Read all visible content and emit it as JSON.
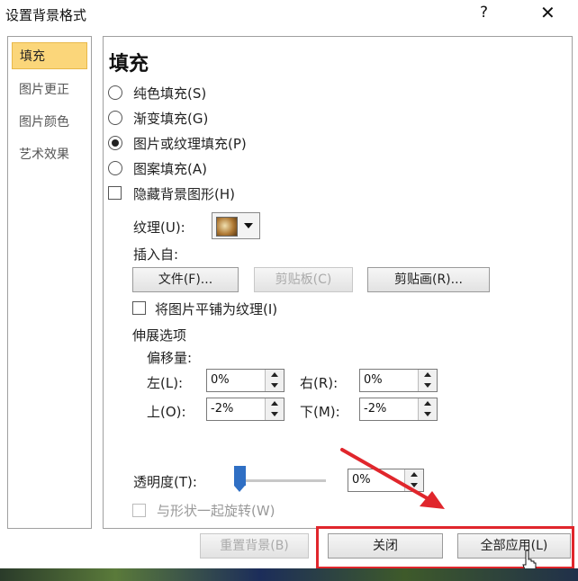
{
  "dialog": {
    "title": "设置背景格式",
    "help": "?",
    "close": "✕"
  },
  "sidebar": {
    "items": [
      {
        "label": "填充",
        "active": true
      },
      {
        "label": "图片更正",
        "active": false
      },
      {
        "label": "图片颜色",
        "active": false
      },
      {
        "label": "艺术效果",
        "active": false
      }
    ]
  },
  "fill": {
    "heading": "填充",
    "radios": [
      {
        "label": "纯色填充(S)",
        "selected": false
      },
      {
        "label": "渐变填充(G)",
        "selected": false
      },
      {
        "label": "图片或纹理填充(P)",
        "selected": true
      },
      {
        "label": "图案填充(A)",
        "selected": false
      }
    ],
    "hide_graphics": {
      "label": "隐藏背景图形(H)",
      "checked": false
    },
    "texture_label": "纹理(U):",
    "insert_from": "插入自:",
    "buttons": {
      "file": "文件(F)...",
      "clipboard": "剪贴板(C)",
      "clipart": "剪贴画(R)..."
    },
    "tile": {
      "label": "将图片平铺为纹理(I)",
      "checked": false
    },
    "stretch_options": "伸展选项",
    "offset": "偏移量:",
    "offsets": {
      "left": {
        "label": "左(L):",
        "value": "0%"
      },
      "right": {
        "label": "右(R):",
        "value": "0%"
      },
      "top": {
        "label": "上(O):",
        "value": "-2%"
      },
      "bottom": {
        "label": "下(M):",
        "value": "-2%"
      }
    },
    "transparency": {
      "label": "透明度(T):",
      "value": "0%",
      "level": 0
    },
    "rotate_with_shape": {
      "label": "与形状一起旋转(W)",
      "checked": false
    }
  },
  "footer": {
    "reset": "重置背景(B)",
    "close": "关闭",
    "apply_all": "全部应用(L)"
  },
  "colors": {
    "accent": "#2f6fc4",
    "highlight": "#e0262c",
    "selected_item": "#fbd67a"
  }
}
